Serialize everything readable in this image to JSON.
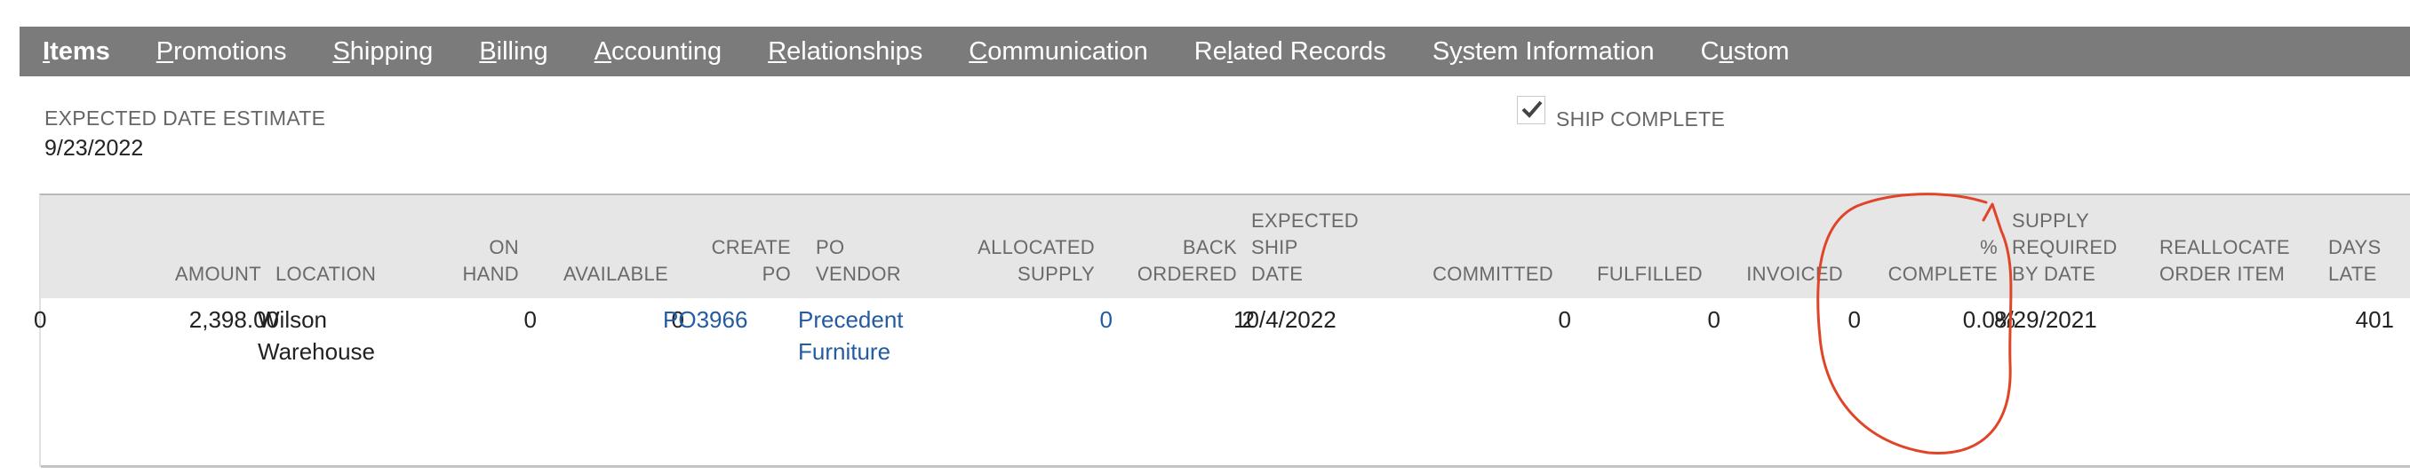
{
  "tabs": [
    {
      "key": "I",
      "rest": "tems",
      "pre": "",
      "active": true
    },
    {
      "key": "P",
      "rest": "romotions",
      "pre": ""
    },
    {
      "key": "S",
      "rest": "hipping",
      "pre": ""
    },
    {
      "key": "B",
      "rest": "illing",
      "pre": ""
    },
    {
      "key": "A",
      "rest": "ccounting",
      "pre": ""
    },
    {
      "key": "R",
      "rest": "elationships",
      "pre": ""
    },
    {
      "key": "C",
      "rest": "ommunication",
      "pre": ""
    },
    {
      "key": "l",
      "rest": "ated Records",
      "pre": "Re"
    },
    {
      "key": "y",
      "rest": "stem Information",
      "pre": "S"
    },
    {
      "key": "u",
      "rest": "stom",
      "pre": "C"
    }
  ],
  "expected_date": {
    "label": "EXPECTED DATE ESTIMATE",
    "value": "9/23/2022"
  },
  "ship_complete": {
    "label": "SHIP COMPLETE",
    "checked": true
  },
  "columns": {
    "amount": "AMOUNT",
    "location": "LOCATION",
    "on_hand": [
      "ON",
      "HAND"
    ],
    "available": "AVAILABLE",
    "create_po": [
      "CREATE",
      "PO"
    ],
    "po_vendor": [
      "PO",
      "VENDOR"
    ],
    "allocated_supply": [
      "ALLOCATED",
      "SUPPLY"
    ],
    "back_ordered": [
      "BACK",
      "ORDERED"
    ],
    "expected_ship_date": [
      "EXPECTED",
      "SHIP",
      "DATE"
    ],
    "committed": "COMMITTED",
    "fulfilled": "FULFILLED",
    "invoiced": "INVOICED",
    "pct_complete": [
      "%",
      "COMPLETE"
    ],
    "supply_required_by_date": [
      "SUPPLY",
      "REQUIRED",
      "BY DATE"
    ],
    "reallocate_order_item": [
      "REALLOCATE",
      "ORDER ITEM"
    ],
    "days_late": [
      "DAYS",
      "LATE"
    ]
  },
  "row": {
    "prev_cut": "0",
    "amount": "2,398.00",
    "location": [
      "Wilson",
      "Warehouse"
    ],
    "on_hand": "0",
    "available": "0",
    "create_po": "PO3966",
    "po_vendor": [
      "Precedent",
      "Furniture"
    ],
    "allocated_supply": "0",
    "back_ordered": "2",
    "expected_ship_date": "10/4/2022",
    "committed": "0",
    "fulfilled": "0",
    "invoiced": "0",
    "pct_complete": "0.0%",
    "supply_required_by_date": "8/29/2021",
    "reallocate_order_item": "",
    "days_late": "401"
  },
  "colors": {
    "tab_bar": "#7b7b7b",
    "header_bg": "#e6e6e6",
    "link": "#245ba2",
    "annotation": "#e0452a"
  }
}
